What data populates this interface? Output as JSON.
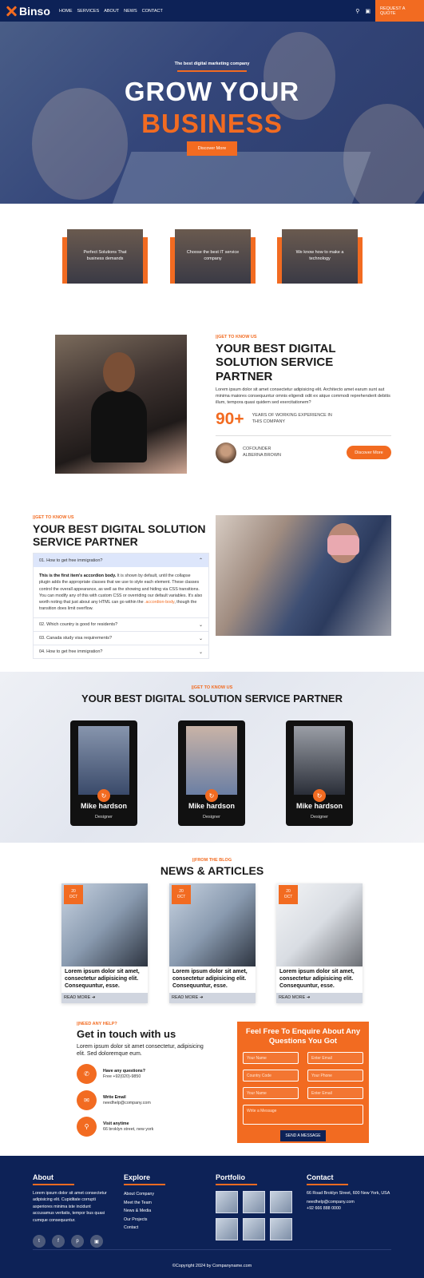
{
  "nav": {
    "brand": "Binso",
    "menu": [
      "HOME",
      "SERVICES",
      "ABOUT",
      "NEWS",
      "CONTACT"
    ],
    "quote_button": "REQUEST A QUOTE"
  },
  "hero": {
    "subtitle": "The best digital marketing company",
    "title_line1": "GROW YOUR",
    "title_line2": "BUSINESS",
    "button": "Discover More"
  },
  "features": [
    {
      "text": "Perfect Solutions That business demands"
    },
    {
      "text": "Choose the best IT service company"
    },
    {
      "text": "We know how to make a technology"
    }
  ],
  "about": {
    "tag": "||GET TO KNOW US",
    "title": "YOUR BEST DIGITAL SOLUTION SERVICE PARTNER",
    "body": "Lorem ipsum dolor sit amet consectetur adipisicing elit. Architecto amet earum sunt aut minima maiores consequuntur omnis eligendi odit ex atque commodi reprehenderit debitis illum, tempora quasi quidem sed exercitationem?",
    "stat_number": "90+",
    "stat_label": "YEARS OF WORKING EXPERIENCE IN THIS COMPANY",
    "founder_role": "COFOUNDER",
    "founder_name": "ALBERNA BROWN",
    "button": "Discover More"
  },
  "faq": {
    "tag": "||GET TO KNOW US",
    "title": "YOUR BEST DIGITAL SOLUTION SERVICE PARTNER",
    "items": [
      {
        "q": "01. How to get free immigration?"
      },
      {
        "q": "02. Which country is good for residents?"
      },
      {
        "q": "03. Canada study visa requirements?"
      },
      {
        "q": "04. How to get free immigration?"
      }
    ],
    "open_body_bold": "This is the first item's accordion body.",
    "open_body_1": " It is shown by default, until the collapse plugin adds the appropriate classes that we use to style each element. These classes control the overall appearance, as well as the showing and hiding via CSS transitions. You can modify any of this with custom CSS or overriding our default variables. It's also worth noting that just about any HTML can go within the ",
    "open_body_link": ".accordion-body",
    "open_body_2": ", though the transition does limit overflow."
  },
  "team": {
    "tag": "||GET TO KNOW US",
    "title": "YOUR BEST DIGITAL SOLUTION SERVICE PARTNER",
    "members": [
      {
        "name": "Mike hardson",
        "role": "Designer"
      },
      {
        "name": "Mike hardson",
        "role": "Designer"
      },
      {
        "name": "Mike hardson",
        "role": "Designer"
      }
    ]
  },
  "blog": {
    "tag": "||FROM THE BLOG",
    "title": "NEWS & ARTICLES",
    "posts": [
      {
        "day": "20",
        "month": "OCT",
        "title": "Lorem ipsum dolor sit amet, consectetur adipisicing elit. Consequuntur, esse.",
        "more": "READ MORE"
      },
      {
        "day": "20",
        "month": "OCT",
        "title": "Lorem ipsum dolor sit amet, consectetur adipisicing elit. Consequuntur, esse.",
        "more": "READ MORE"
      },
      {
        "day": "20",
        "month": "OCT",
        "title": "Lorem ipsum dolor sit amet, consectetur adipisicing elit. Consequuntur, esse.",
        "more": "READ MORE"
      }
    ]
  },
  "contact": {
    "tag": "||NEED ANY HELP?",
    "title": "Get in touch with us",
    "intro": "Lorem ipsum dolor sit amet consectetur, adipisicing elit. Sed doloremque eum.",
    "items": [
      {
        "title": "Have any questions?",
        "value": "Free +92(020)-9850"
      },
      {
        "title": "Write Email",
        "value": "needhelp@company.com"
      },
      {
        "title": "Visit anytime",
        "value": "66 broklyn street, new york"
      }
    ],
    "form_title": "Feel Free To Enquire About Any Questions You Got",
    "placeholders": {
      "name1": "Your Name",
      "email1": "Enter Email",
      "country": "Country Code",
      "phone": "Your Phone",
      "name2": "Your Name",
      "email2": "Enter Email",
      "message": "Write a Message"
    },
    "send": "SEND A MESSAGE"
  },
  "footer": {
    "about_title": "About",
    "about_text": "Lorem ipsum dolor sit amet consectetur adipisicing elit. Cupiditate corrupti asperiores minima iste incidunt accusamus veritatis, tempor bus quasi cumque consequuntur.",
    "explore_title": "Explore",
    "explore_links": [
      "About Company",
      "Meet the Team",
      "News & Media",
      "Our Projects",
      "Contact"
    ],
    "portfolio_title": "Portfolio",
    "contact_title": "Contact",
    "contact_address": "66 Road Broklyn Street, 600 New York, USA",
    "contact_email": "needhelp@company.com",
    "contact_phone": "+92 666 888 0000",
    "copyright": "©Copyright 2024 by Companyname.com"
  },
  "colors": {
    "accent": "#f26b21",
    "navy": "#0d2257"
  }
}
